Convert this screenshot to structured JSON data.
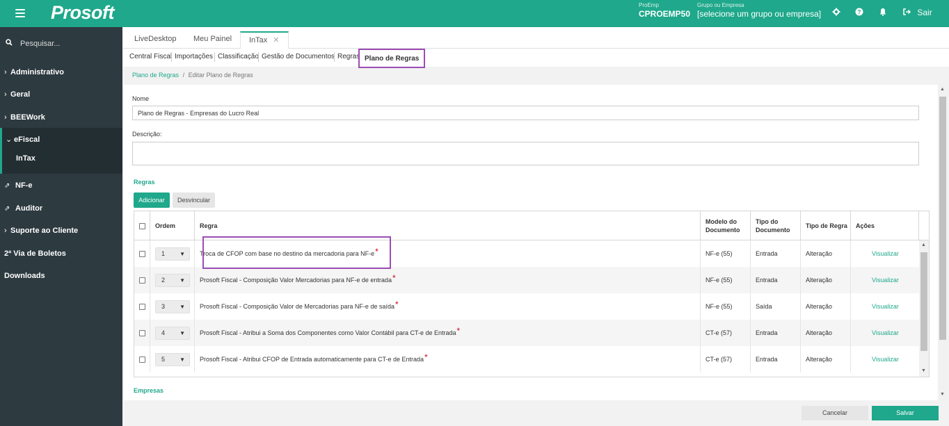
{
  "topbar": {
    "logo": "Prosoft",
    "proemp_label": "ProEmp",
    "proemp_value": "CPROEMP50",
    "grupo_label": "Grupo ou Empresa",
    "grupo_value": "[selecione um grupo ou empresa]",
    "sair_label": "Sair"
  },
  "sidebar": {
    "search_placeholder": "Pesquisar...",
    "items": [
      {
        "label": "Administrativo"
      },
      {
        "label": "Geral"
      },
      {
        "label": "BEEWork"
      }
    ],
    "efiscal": {
      "label": "eFiscal",
      "sub": "InTax"
    },
    "items2": [
      {
        "label": "NF-e"
      },
      {
        "label": "Auditor"
      },
      {
        "label": "Suporte ao Cliente"
      },
      {
        "label": "2ª Via de Boletos"
      },
      {
        "label": "Downloads"
      }
    ]
  },
  "tabs": [
    {
      "label": "LiveDesktop"
    },
    {
      "label": "Meu Painel"
    },
    {
      "label": "InTax",
      "close": "✕"
    }
  ],
  "subnav": [
    {
      "label": "Central Fiscal"
    },
    {
      "label": "Importações"
    },
    {
      "label": "Classificação"
    },
    {
      "label": "Gestão de Documentos"
    },
    {
      "label": "Regras"
    },
    {
      "label": "Plano de Regras"
    }
  ],
  "breadcrumb": {
    "link": "Plano de Regras",
    "sep": "/",
    "current": "Editar Plano de Regras"
  },
  "form": {
    "nome_label": "Nome",
    "nome_value": "Plano de Regras - Empresas do Lucro Real",
    "descricao_label": "Descrição:",
    "descricao_value": "",
    "regras_title": "Regras",
    "adicionar_label": "Adicionar",
    "desvincular_label": "Desvincular",
    "empresas_title": "Empresas"
  },
  "table": {
    "headers": {
      "ordem": "Ordem",
      "regra": "Regra",
      "modelo_1": "Modelo do",
      "modelo_2": "Documento",
      "tipo_doc_1": "Tipo do",
      "tipo_doc_2": "Documento",
      "tipo_regra": "Tipo de Regra",
      "acoes": "Ações"
    },
    "rows": [
      {
        "ordem": "1",
        "regra": "Troca de CFOP com base no destino da mercadoria para NF-e",
        "req": "*",
        "modelo": "NF-e (55)",
        "tipo_doc": "Entrada",
        "tipo_regra": "Alteração",
        "acao": "Visualizar"
      },
      {
        "ordem": "2",
        "regra": "Prosoft Fiscal - Composição Valor Mercadorias para NF-e de entrada",
        "req": "*",
        "modelo": "NF-e (55)",
        "tipo_doc": "Entrada",
        "tipo_regra": "Alteração",
        "acao": "Visualizar"
      },
      {
        "ordem": "3",
        "regra": "Prosoft Fiscal - Composição Valor de Mercadorias para NF-e de saída",
        "req": "*",
        "modelo": "NF-e (55)",
        "tipo_doc": "Saída",
        "tipo_regra": "Alteração",
        "acao": "Visualizar"
      },
      {
        "ordem": "4",
        "regra": "Prosoft Fiscal - Atribui a Soma dos Componentes como Valor Contábil para CT-e de Entrada",
        "req": "*",
        "modelo": "CT-e (57)",
        "tipo_doc": "Entrada",
        "tipo_regra": "Alteração",
        "acao": "Visualizar"
      },
      {
        "ordem": "5",
        "regra": "Prosoft Fiscal - Atribui CFOP de Entrada automaticamente para CT-e de Entrada",
        "req": "*",
        "modelo": "CT-e (57)",
        "tipo_doc": "Entrada",
        "tipo_regra": "Alteração",
        "acao": "Visualizar"
      }
    ]
  },
  "footer": {
    "cancelar": "Cancelar",
    "salvar": "Salvar"
  },
  "colors": {
    "accent": "#1fa88b",
    "sidebar": "#2d3a40",
    "highlight": "#9b4db3",
    "required": "#d0021b"
  },
  "icons": [
    "menu-icon",
    "gear-icon",
    "help-icon",
    "bell-icon",
    "logout-icon",
    "search-icon",
    "chevron-right-icon",
    "chevron-down-icon",
    "external-link-icon",
    "close-icon",
    "dropdown-arrow-icon"
  ]
}
